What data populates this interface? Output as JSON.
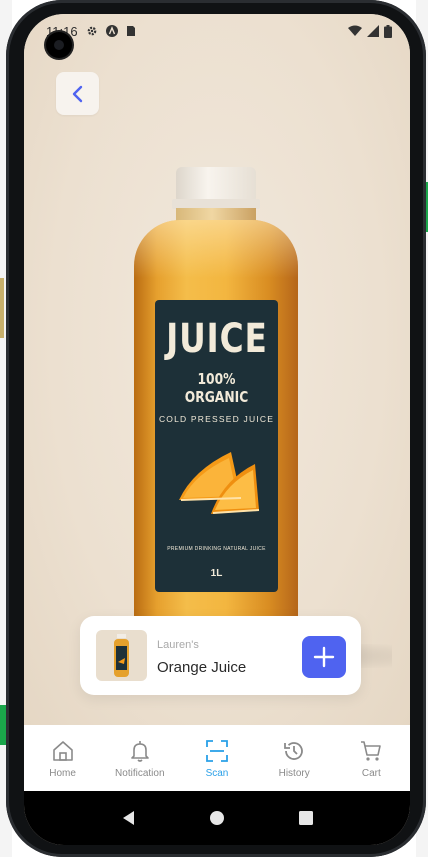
{
  "status_bar": {
    "time": "11:16",
    "icons_left": [
      "gear-icon",
      "a-icon",
      "sim-icon"
    ],
    "icons_right": [
      "wifi-icon",
      "signal-icon",
      "battery-icon"
    ]
  },
  "product_image": {
    "label_title": "JUICE",
    "label_subtitle": "100% ORGANIC",
    "label_tagline": "COLD PRESSED JUICE",
    "label_footer": "PREMIUM DRINKING NATURAL JUICE",
    "label_size": "1L"
  },
  "product_card": {
    "brand": "Lauren's",
    "name": "Orange Juice",
    "add_icon": "plus-icon"
  },
  "bottom_nav": {
    "items": [
      {
        "label": "Home",
        "icon": "home-icon"
      },
      {
        "label": "Notification",
        "icon": "bell-icon"
      },
      {
        "label": "Scan",
        "icon": "scan-icon"
      },
      {
        "label": "History",
        "icon": "history-icon"
      },
      {
        "label": "Cart",
        "icon": "cart-icon"
      }
    ],
    "active": "Scan",
    "active_color": "#2aa0e8",
    "inactive_color": "#8a8a8a"
  },
  "colors": {
    "accent": "#4f63f0",
    "background": "#ede2d3"
  }
}
